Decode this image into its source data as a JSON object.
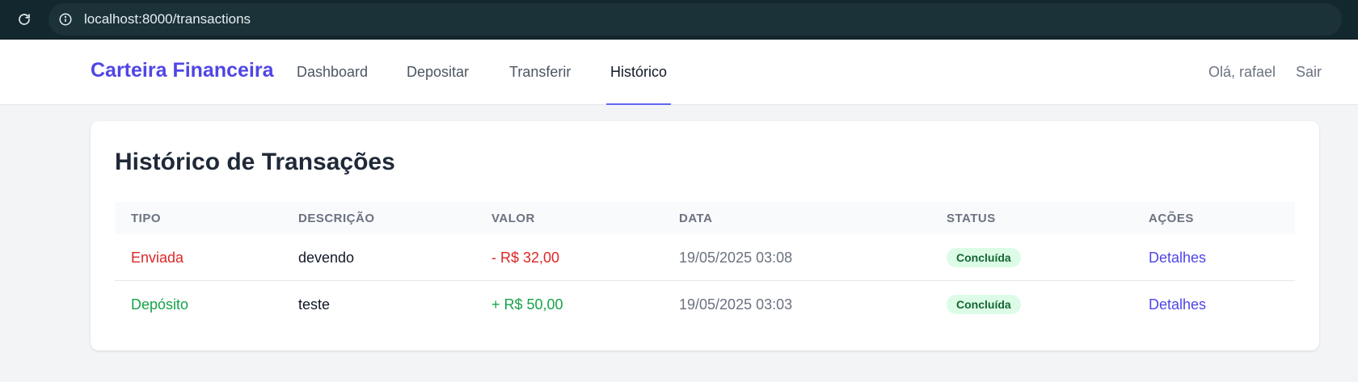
{
  "browser": {
    "url": "localhost:8000/transactions",
    "reload_icon": "reload-icon",
    "info_icon": "info-icon"
  },
  "nav": {
    "brand": "Carteira Financeira",
    "links": [
      "Dashboard",
      "Depositar",
      "Transferir",
      "Histórico"
    ],
    "active": "Histórico",
    "greeting": "Olá, rafael",
    "logout": "Sair"
  },
  "page": {
    "title": "Histórico de Transações"
  },
  "table": {
    "headers": [
      "TIPO",
      "DESCRIÇÃO",
      "VALOR",
      "DATA",
      "STATUS",
      "AÇÕES"
    ],
    "rows": [
      {
        "tipo": "Enviada",
        "descricao": "devendo",
        "valor": "- R$ 32,00",
        "data": "19/05/2025 03:08",
        "status": "Concluída",
        "acao": "Detalhes"
      },
      {
        "tipo": "Depósito",
        "descricao": "teste",
        "valor": "+ R$ 50,00",
        "data": "19/05/2025 03:03",
        "status": "Concluída",
        "acao": "Detalhes"
      }
    ]
  },
  "colors": {
    "brand": "#4f46e5",
    "debit": "#dc2626",
    "credit": "#16a34a",
    "badge_bg": "#dcfce7",
    "badge_text": "#166534"
  }
}
